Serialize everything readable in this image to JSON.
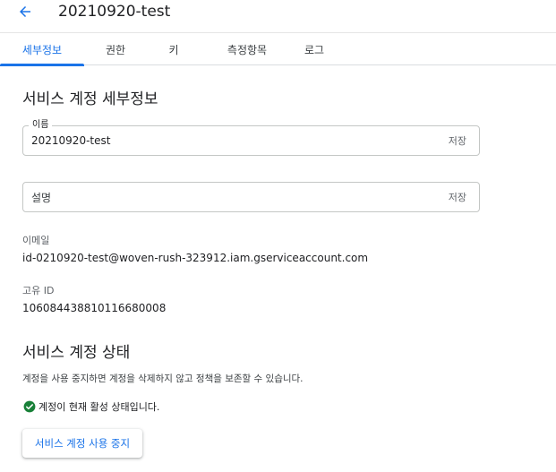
{
  "header": {
    "back_icon": "arrow-back-icon",
    "title": "20210920-test"
  },
  "tabs": [
    {
      "label": "세부정보",
      "active": true
    },
    {
      "label": "권한",
      "active": false
    },
    {
      "label": "키",
      "active": false
    },
    {
      "label": "측정항목",
      "active": false
    },
    {
      "label": "로그",
      "active": false
    }
  ],
  "details": {
    "title": "서비스 계정 세부정보",
    "name_field": {
      "label": "이름",
      "value": "20210920-test",
      "save_label": "저장"
    },
    "description_field": {
      "placeholder": "설명",
      "save_label": "저장"
    },
    "email": {
      "label": "이메일",
      "value": "id-0210920-test@woven-rush-323912.iam.gserviceaccount.com"
    },
    "unique_id": {
      "label": "고유 ID",
      "value": "106084438810116680008"
    }
  },
  "status": {
    "title": "서비스 계정 상태",
    "description": "계정을 사용 중지하면 계정을 삭제하지 않고 정책을 보존할 수 있습니다.",
    "active_text": "계정이 현재 활성 상태입니다.",
    "active_icon": "check-circle-icon",
    "disable_button_label": "서비스 계정 사용 중지"
  },
  "colors": {
    "accent": "#1a73e8",
    "success": "#188038"
  }
}
